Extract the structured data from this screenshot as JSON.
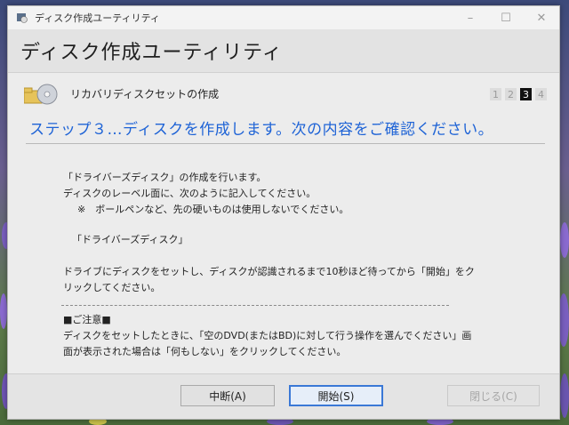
{
  "window": {
    "title": "ディスク作成ユーティリティ",
    "controls": {
      "minimize": "–",
      "maximize": "☐",
      "close": "✕"
    }
  },
  "header": {
    "title": "ディスク作成ユーティリティ"
  },
  "task": {
    "label": "リカバリディスクセットの作成",
    "icon": "disc-folder-icon"
  },
  "steps": [
    "1",
    "2",
    "3",
    "4"
  ],
  "active_step": "3",
  "step_heading": "ステップ３…ディスクを作成します。次の内容をご確認ください。",
  "content": {
    "line1": "「ドライバーズディスク」の作成を行います。",
    "line2": "ディスクのレーベル面に、次のように記入してください。",
    "line3": "※　ボールペンなど、先の硬いものは使用しないでください。",
    "label_text": "「ドライバーズディスク」",
    "instr1": "ドライブにディスクをセットし、ディスクが認識されるまで10秒ほど待ってから「開始」をク",
    "instr2": "リックしてください。",
    "note_title": "■ご注意■",
    "note1": "ディスクをセットしたときに、「空のDVD(またはBD)に対して行う操作を選んでください」画",
    "note2": "面が表示された場合は「何もしない」をクリックしてください。"
  },
  "buttons": {
    "abort": "中断(A)",
    "start": "開始(S)",
    "close": "閉じる(C)"
  },
  "colors": {
    "accent": "#1e63d6",
    "primary_border": "#3a78d6"
  }
}
